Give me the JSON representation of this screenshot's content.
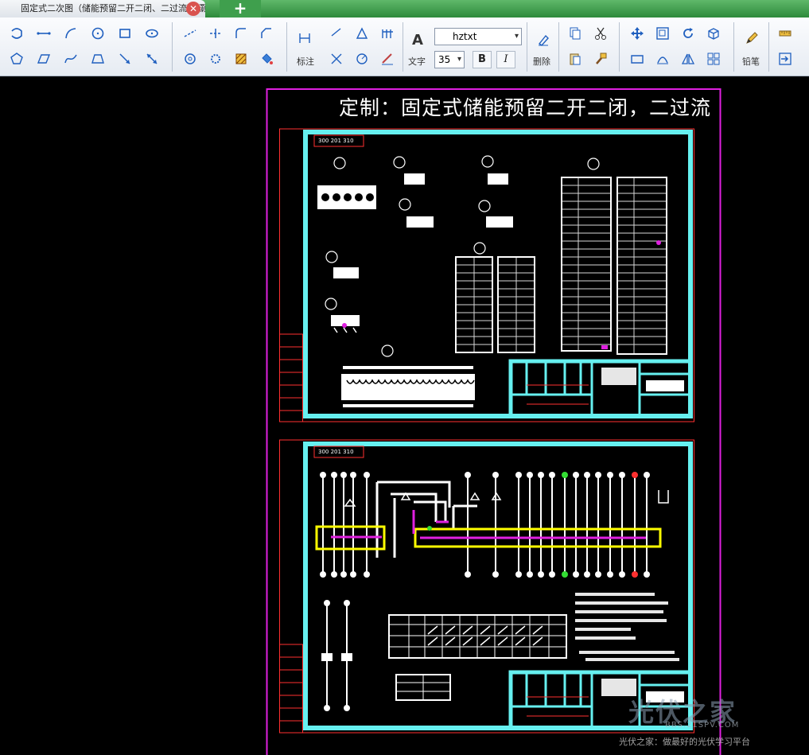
{
  "tab": {
    "title": "固定式二次图（储能预留二开二闭、二过流）-灏",
    "close_glyph": "✕",
    "new_glyph": "+"
  },
  "ribbon": {
    "annotate_label": "标注",
    "text_label": "文字",
    "delete_label": "删除",
    "pencil_label": "铅笔",
    "font_name": "hztxt",
    "font_size": "35",
    "bold_label": "B",
    "italic_label": "I",
    "text_icon_glyph": "A",
    "dropdown_glyph": "▾"
  },
  "drawing": {
    "title": "定制：固定式储能预留二开二闭，二过流",
    "frame_color": "#e020e0",
    "border_color": "#66f0f0",
    "sheet_line_color": "#ff3030",
    "highlight_color": "#ffff00"
  },
  "watermark": {
    "logo": "光伏之家",
    "url": "BBS.21SPV.COM",
    "slogan": "光伏之家：做最好的光伏学习平台"
  }
}
